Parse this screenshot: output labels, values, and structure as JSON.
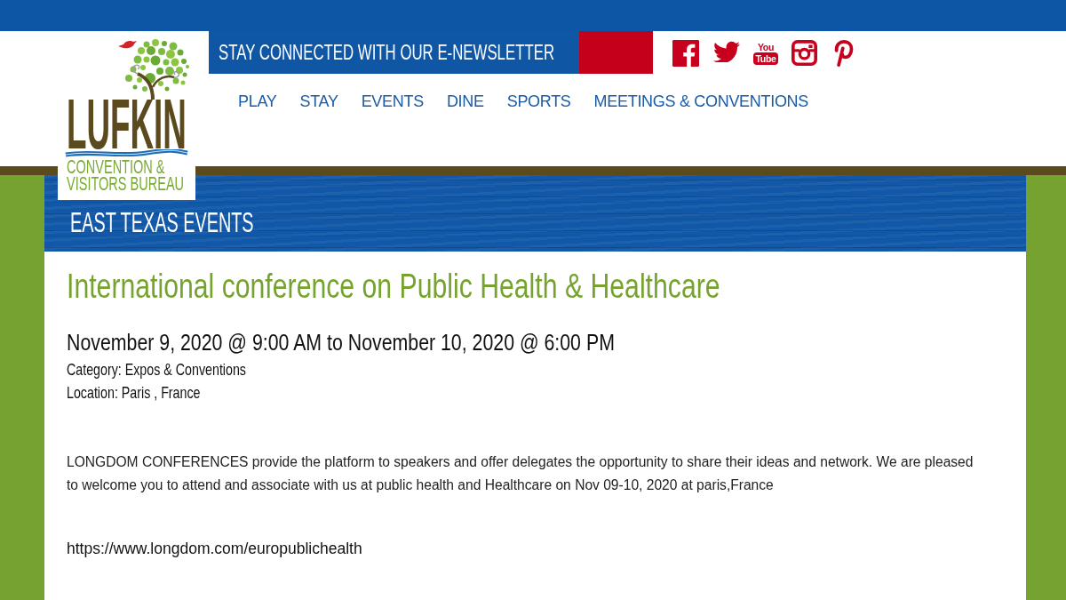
{
  "header": {
    "newsletter": {
      "label": "STAY CONNECTED WITH OUR E-NEWSLETTER"
    },
    "social": [
      {
        "kind": "facebook"
      },
      {
        "kind": "twitter"
      },
      {
        "kind": "youtube",
        "lines": [
          "You",
          "Tube"
        ]
      },
      {
        "kind": "instagram"
      },
      {
        "kind": "pinterest"
      }
    ],
    "nav": [
      {
        "label": "PLAY"
      },
      {
        "label": "STAY"
      },
      {
        "label": "EVENTS"
      },
      {
        "label": "DINE"
      },
      {
        "label": "SPORTS"
      },
      {
        "label": "MEETINGS & CONVENTIONS"
      }
    ]
  },
  "logo": {
    "wordmark": "LUFKIN",
    "tagline": [
      "CONVENTION &",
      "VISITORS BUREAU"
    ]
  },
  "banner": {
    "title": "EAST TEXAS EVENTS"
  },
  "event": {
    "title": "International conference on Public Health & Healthcare",
    "date": "November 9, 2020 @ 9:00 AM to November 10, 2020 @ 6:00 PM",
    "category": "Category: Expos & Conventions",
    "location": "Location: Paris , France",
    "description": "LONGDOM CONFERENCES provide the platform to speakers and offer delegates the opportunity to share their ideas and network. We are pleased to welcome you to attend and associate with us at public health and Healthcare on Nov 09-10, 2020 at paris,France",
    "url": "https://www.longdom.com/europublichealth"
  }
}
